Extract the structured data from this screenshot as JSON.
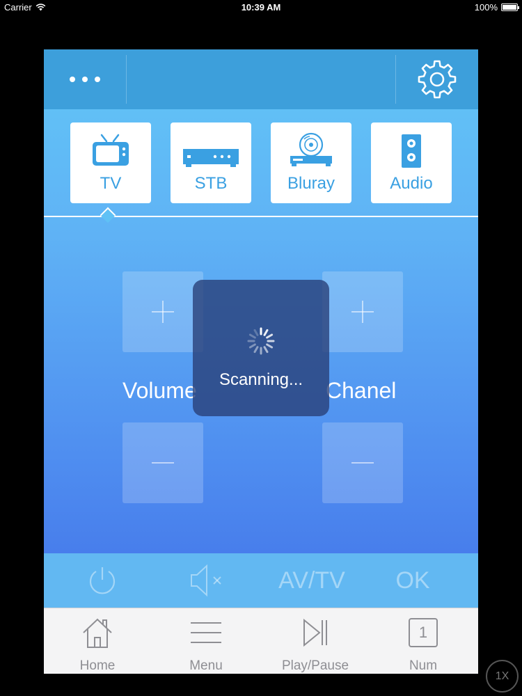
{
  "status_bar": {
    "carrier": "Carrier",
    "time": "10:39 AM",
    "battery": "100%"
  },
  "device_tabs": [
    {
      "label": "TV",
      "icon": "tv-icon",
      "selected": true
    },
    {
      "label": "STB",
      "icon": "set-top-box-icon",
      "selected": false
    },
    {
      "label": "Bluray",
      "icon": "bluray-player-icon",
      "selected": false
    },
    {
      "label": "Audio",
      "icon": "speaker-icon",
      "selected": false
    }
  ],
  "controls": {
    "volume_label": "Volume",
    "channel_label": "Chanel",
    "plus_glyph": "+",
    "minus_glyph": "−"
  },
  "hud": {
    "text": "Scanning..."
  },
  "control_bar": {
    "power_icon": "power-icon",
    "mute_icon": "mute-icon",
    "av_tv_label": "AV/TV",
    "ok_label": "OK"
  },
  "tab_bar": [
    {
      "label": "Home",
      "icon": "home-icon"
    },
    {
      "label": "Menu",
      "icon": "menu-icon"
    },
    {
      "label": "Play/Pause",
      "icon": "play-pause-icon"
    },
    {
      "label": "Num",
      "icon": "num-icon",
      "glyph": "1"
    }
  ],
  "zoom_badge": "1X",
  "colors": {
    "top_bar": "#3d9fdb",
    "accent": "#3aa0e2",
    "tab_bar_bg": "#f4f4f5",
    "tab_bar_text": "#8e8e93"
  }
}
